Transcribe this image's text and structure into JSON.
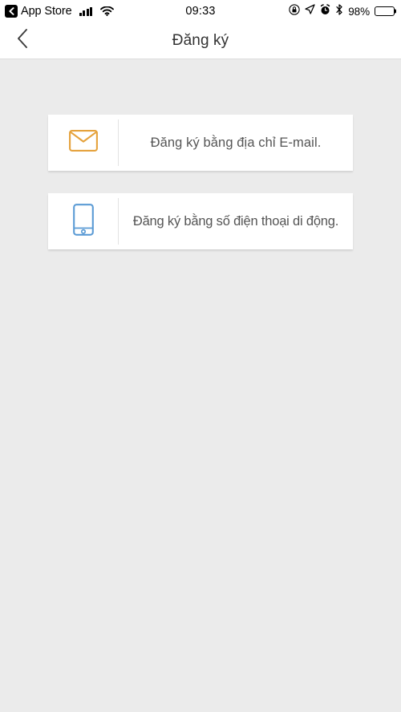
{
  "status_bar": {
    "back_app_label": "App Store",
    "back_icon": "chevron-left-icon",
    "signal_icon": "cellular-signal-icon",
    "wifi_icon": "wifi-icon",
    "time": "09:33",
    "right_icons": [
      "rotation-lock-icon",
      "location-arrow-icon",
      "alarm-clock-icon",
      "bluetooth-icon"
    ],
    "battery_percent": "98%",
    "battery_icon": "battery-icon"
  },
  "nav_bar": {
    "back_icon": "chevron-left-icon",
    "title": "Đăng ký"
  },
  "options": [
    {
      "icon": "envelope-icon",
      "icon_color": "#E5A23C",
      "label": "Đăng ký bằng địa chỉ E-mail."
    },
    {
      "icon": "mobile-phone-icon",
      "icon_color": "#5B9BD5",
      "label": "Đăng ký bằng số điện thoại di động."
    }
  ],
  "colors": {
    "background": "#EBEBEB",
    "card_background": "#FFFFFF",
    "text": "#555555",
    "title": "#333333",
    "accent_orange": "#E5A23C",
    "accent_blue": "#5B9BD5"
  }
}
